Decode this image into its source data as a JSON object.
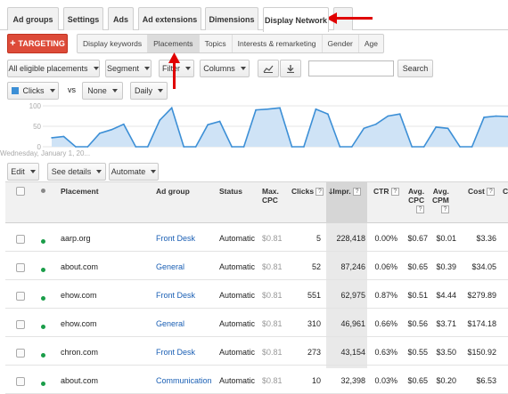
{
  "tabs": [
    {
      "label": "Ad groups"
    },
    {
      "label": "Settings"
    },
    {
      "label": "Ads"
    },
    {
      "label": "Ad extensions"
    },
    {
      "label": "Dimensions"
    },
    {
      "label": "Display Network"
    }
  ],
  "targeting": {
    "label": "TARGETING",
    "icon": "plus-icon"
  },
  "subtabs": [
    {
      "label": "Display keywords"
    },
    {
      "label": "Placements"
    },
    {
      "label": "Topics"
    },
    {
      "label": "Interests & remarketing"
    },
    {
      "label": "Gender"
    },
    {
      "label": "Age"
    }
  ],
  "toolbar": {
    "filter_scope": "All eligible placements",
    "segment": "Segment",
    "filter": "Filter",
    "columns": "Columns",
    "search_label": "Search",
    "search_placeholder": ""
  },
  "chart_controls": {
    "metric1": "Clicks",
    "vs": "vs",
    "metric2": "None",
    "granularity": "Daily"
  },
  "chart_data": {
    "type": "area",
    "ylabel": "",
    "ylim": [
      0,
      100
    ],
    "yticks": [
      "100",
      "50",
      "0"
    ],
    "x_label_start": "Wednesday, January 1, 20...",
    "color": "#3c8fd6",
    "values": [
      22,
      25,
      0,
      0,
      33,
      42,
      55,
      0,
      0,
      65,
      95,
      0,
      0,
      54,
      62,
      0,
      0,
      90,
      92,
      95,
      0,
      0,
      92,
      80,
      0,
      0,
      45,
      55,
      75,
      80,
      0,
      0,
      48,
      45,
      0,
      0,
      72,
      75,
      74
    ]
  },
  "table_actions": {
    "edit": "Edit",
    "see_details": "See details",
    "automate": "Automate"
  },
  "table": {
    "headers": {
      "placement": "Placement",
      "ad_group": "Ad group",
      "status": "Status",
      "max_cpc_1": "Max.",
      "max_cpc_2": "CPC",
      "clicks": "Clicks",
      "impr": "Impr.",
      "ctr": "CTR",
      "avg_cpc_1": "Avg.",
      "avg_cpc_2": "CPC",
      "avg_cpm_1": "Avg.",
      "avg_cpm_2": "CPM",
      "cost": "Cost",
      "conv": "C",
      "help": "?",
      "sort_arrow": "🡓"
    },
    "rows": [
      {
        "placement": "aarp.org",
        "ad_group": "Front Desk",
        "status": "Automatic",
        "max_cpc": "$0.81",
        "clicks": "5",
        "impr": "228,418",
        "ctr": "0.00%",
        "avg_cpc": "$0.67",
        "avg_cpm": "$0.01",
        "cost": "$3.36"
      },
      {
        "placement": "about.com",
        "ad_group": "General",
        "status": "Automatic",
        "max_cpc": "$0.81",
        "clicks": "52",
        "impr": "87,246",
        "ctr": "0.06%",
        "avg_cpc": "$0.65",
        "avg_cpm": "$0.39",
        "cost": "$34.05"
      },
      {
        "placement": "ehow.com",
        "ad_group": "Front Desk",
        "status": "Automatic",
        "max_cpc": "$0.81",
        "clicks": "551",
        "impr": "62,975",
        "ctr": "0.87%",
        "avg_cpc": "$0.51",
        "avg_cpm": "$4.44",
        "cost": "$279.89"
      },
      {
        "placement": "ehow.com",
        "ad_group": "General",
        "status": "Automatic",
        "max_cpc": "$0.81",
        "clicks": "310",
        "impr": "46,961",
        "ctr": "0.66%",
        "avg_cpc": "$0.56",
        "avg_cpm": "$3.71",
        "cost": "$174.18"
      },
      {
        "placement": "chron.com",
        "ad_group": "Front Desk",
        "status": "Automatic",
        "max_cpc": "$0.81",
        "clicks": "273",
        "impr": "43,154",
        "ctr": "0.63%",
        "avg_cpc": "$0.55",
        "avg_cpm": "$3.50",
        "cost": "$150.92"
      },
      {
        "placement": "about.com",
        "ad_group": "Communication",
        "status": "Automatic",
        "max_cpc": "$0.81",
        "clicks": "10",
        "impr": "32,398",
        "ctr": "0.03%",
        "avg_cpc": "$0.65",
        "avg_cpm": "$0.20",
        "cost": "$6.53"
      }
    ]
  },
  "colors": {
    "accent_red": "#dd4b39",
    "annotation_red": "#e00000",
    "link_blue": "#1a5fb4",
    "chart_blue": "#3c8fd6",
    "status_green": "#1a9d49"
  }
}
